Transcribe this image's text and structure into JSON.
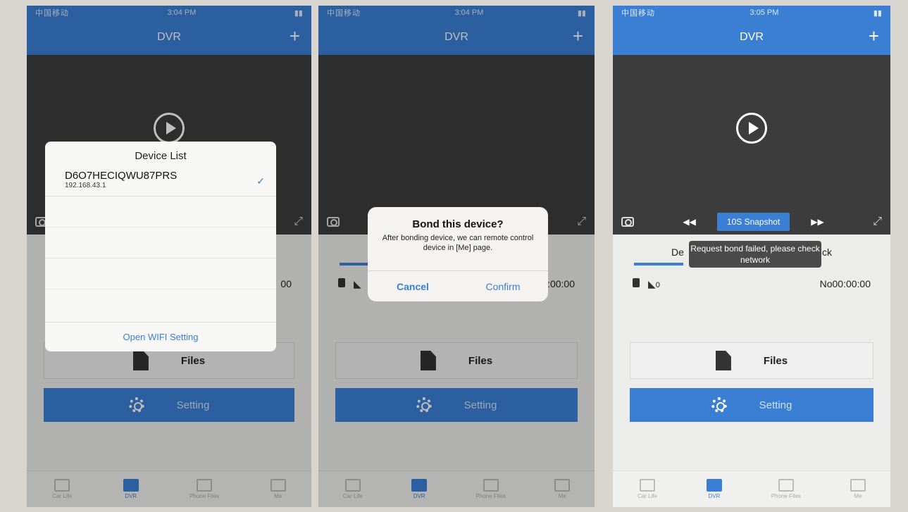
{
  "screens": [
    {
      "status": {
        "carrier": "中国移动",
        "time": "3:04 PM"
      },
      "title": "DVR",
      "plus": "+",
      "time_readout": "00",
      "files_label": "Files",
      "setting_label": "Setting",
      "dialog": {
        "title": "Device List",
        "device_name": "D6O7HECIQWU87PRS",
        "device_ip": "192.168.43.1",
        "wifi_link": "Open WIFI Setting"
      }
    },
    {
      "status": {
        "carrier": "中国移动",
        "time": "3:04 PM"
      },
      "title": "DVR",
      "plus": "+",
      "time_readout": "00:00:00",
      "files_label": "Files",
      "setting_label": "Setting",
      "alert": {
        "title": "Bond this device?",
        "message": "After bonding device, we can remote control device in [Me] page.",
        "cancel": "Cancel",
        "confirm": "Confirm"
      }
    },
    {
      "status": {
        "carrier": "中国移动",
        "time": "3:05 PM"
      },
      "title": "DVR",
      "plus": "+",
      "snapshot_label": "10S Snapshot",
      "tab_left": "De",
      "tab_right": "ck",
      "mute_count": "0",
      "time_readout": "No00:00:00",
      "files_label": "Files",
      "setting_label": "Setting",
      "toast": "Request bond failed, please check network"
    }
  ],
  "bottom_nav": [
    "Car Life",
    "DVR",
    "Phone Files",
    "Me"
  ],
  "accent_color": "#3b7fd4"
}
